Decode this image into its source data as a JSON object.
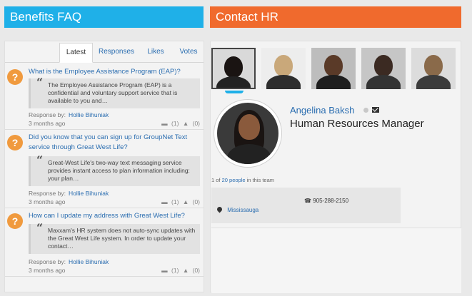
{
  "faq": {
    "title": "Benefits FAQ",
    "tabs": [
      "Latest",
      "Responses",
      "Likes",
      "Votes"
    ],
    "items": [
      {
        "question": "What is the Employee Assistance Program (EAP)?",
        "answer": "The Employee Assistance Program (EAP) is a confidential and voluntary support service that is available to you and…",
        "response_label": "Response by:",
        "responder": "Hollie Bihuniak",
        "time": "3 months ago",
        "votes": [
          "(1)",
          "(0)"
        ]
      },
      {
        "question": "Did you know that you can sign up for GroupNet Text service through Great West Life?",
        "answer": "Great-West Life's two-way text messaging service provides instant access to plan information including: your plan…",
        "response_label": "Response by:",
        "responder": "Hollie Bihuniak",
        "time": "3 months ago",
        "votes": [
          "(1)",
          "(0)"
        ]
      },
      {
        "question": "How can I update my address with Great West Life?",
        "answer": "Maxxam's HR system does not auto-sync updates with the Great West Life system. In order to update your contact…",
        "response_label": "Response by:",
        "responder": "Hollie Bihuniak",
        "time": "3 months ago",
        "votes": [
          "(1)",
          "(0)"
        ]
      }
    ]
  },
  "hr": {
    "title": "Contact HR",
    "person": {
      "name": "Angelina Baksh",
      "job_title": "Human Resources Manager",
      "phone": "905-288-2150",
      "location": "Mississauga"
    },
    "count_prefix": "1 of",
    "count_link": "20 people",
    "count_suffix": "in this team",
    "thumb_colors": [
      "#3a3a3a",
      "#d8d8d8",
      "#9a9a9a",
      "#a9a9a9",
      "#cfcfcf"
    ]
  },
  "colors": {
    "faq_accent": "#1fb0e8",
    "hr_accent": "#f06a2d",
    "link": "#2a6db0",
    "question_icon": "#f09a3e"
  }
}
